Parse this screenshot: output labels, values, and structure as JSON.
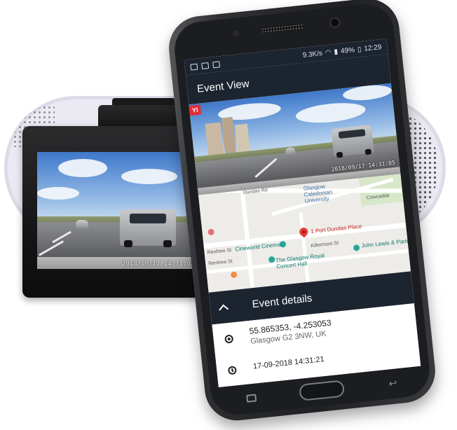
{
  "camera": {
    "timestamp": "2018/09/17  14:31:05"
  },
  "phone": {
    "status_bar": {
      "left_icons": [
        "sd-icon",
        "cast-icon",
        "notification-icon"
      ],
      "speed": "9.3K/s",
      "battery": "49%",
      "time": "12:29"
    },
    "app_bar": {
      "title": "Event View"
    },
    "video": {
      "logo": "YI",
      "timestamp": "2018/09/17  14:31:05"
    },
    "map": {
      "labels": {
        "university": "Glasgow Caledonian University",
        "cowcaddens": "Cowcadde",
        "pin_label": "1 Port Dundas Place",
        "cinema": "Cineworld Cinema",
        "concert_hall": "The Glasgow Royal Concert Hall",
        "john_lewis": "John Lewis & Partne",
        "renfrew_st_1": "Renfrew St",
        "renfrew_st_2": "Renfrew St",
        "killermont": "Killermont St",
        "road_top": "Dundas Rd"
      }
    },
    "details": {
      "title": "Event details",
      "coordinates": "55.865353, -4.253053",
      "address": "Glasgow G2 3NW, UK",
      "datetime": "17-09-2018 14:31:21"
    }
  },
  "colors": {
    "app_dark": "#1c2430",
    "pin_red": "#e53935",
    "brand_red": "#e32b33",
    "pill_bg": "#ebeaf3"
  }
}
